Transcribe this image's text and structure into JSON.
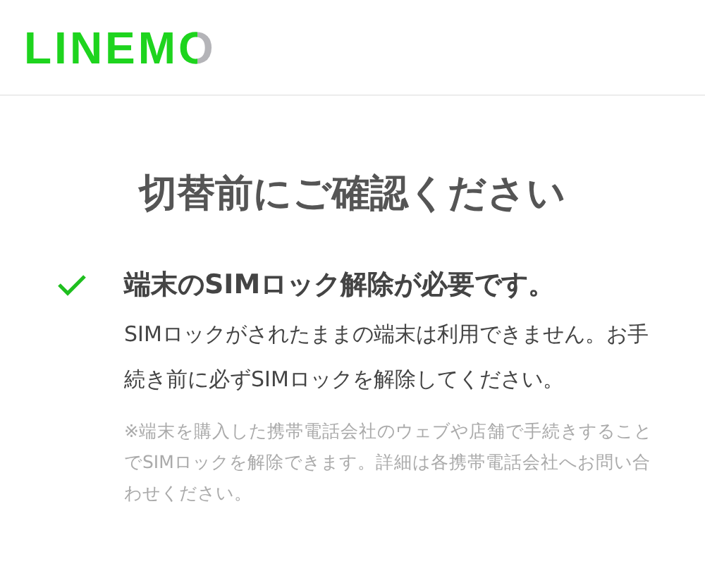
{
  "header": {
    "logo": "LINEMO"
  },
  "title": "切替前にご確認ください",
  "items": [
    {
      "checked": true,
      "heading": "端末のSIMロック解除が必要です。",
      "body": "SIMロックがされたままの端末は利用できません。お手続き前に必ずSIMロックを解除してください。",
      "note": "※端末を購入した携帯電話会社のウェブや店舗で手続きすることでSIMロックを解除できます。詳細は各携帯電話会社へお問い合わせください。"
    }
  ]
}
